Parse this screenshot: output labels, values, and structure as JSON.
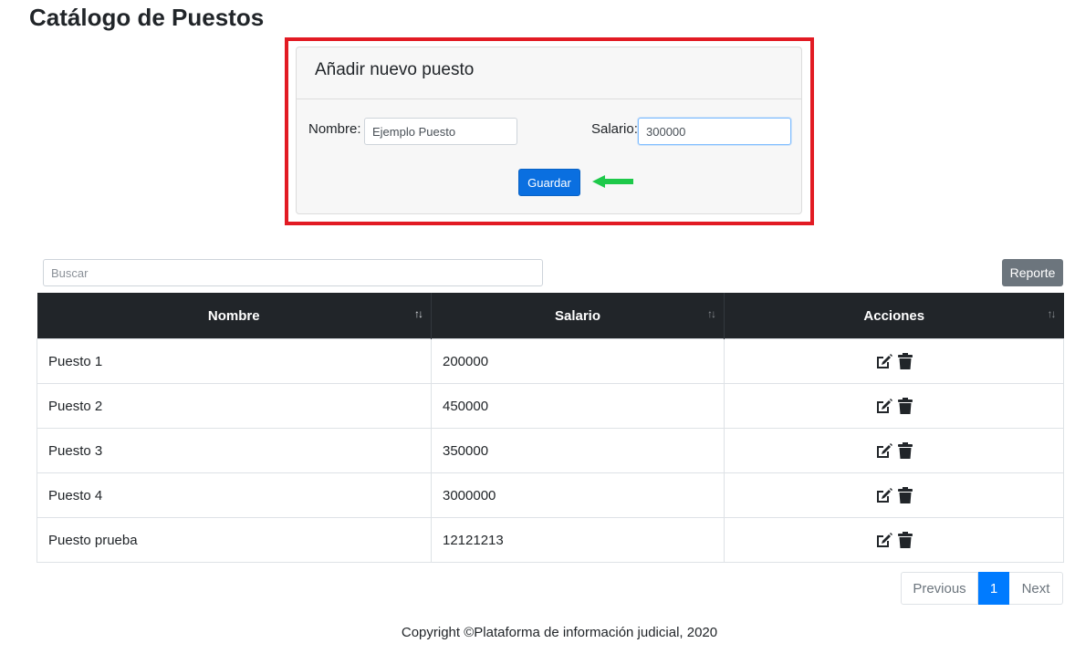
{
  "page": {
    "title": "Catálogo de Puestos"
  },
  "form": {
    "title": "Añadir nuevo puesto",
    "name_label": "Nombre:",
    "name_value": "Ejemplo Puesto",
    "salary_label": "Salario:",
    "salary_value": "300000",
    "save_label": "Guardar",
    "highlight_color": "#e21b23",
    "arrow_color": "#1ec94a"
  },
  "toolbar": {
    "search_placeholder": "Buscar",
    "report_label": "Reporte"
  },
  "table": {
    "columns": [
      "Nombre",
      "Salario",
      "Acciones"
    ],
    "rows": [
      {
        "nombre": "Puesto 1",
        "salario": "200000"
      },
      {
        "nombre": "Puesto 2",
        "salario": "450000"
      },
      {
        "nombre": "Puesto 3",
        "salario": "350000"
      },
      {
        "nombre": "Puesto 4",
        "salario": "3000000"
      },
      {
        "nombre": "Puesto prueba",
        "salario": "12121213"
      }
    ],
    "action_icons": [
      "edit-icon",
      "trash-icon"
    ]
  },
  "pagination": {
    "previous_label": "Previous",
    "current_page": "1",
    "next_label": "Next"
  },
  "footer": {
    "text": "Copyright ©Plataforma de información judicial, 2020"
  }
}
